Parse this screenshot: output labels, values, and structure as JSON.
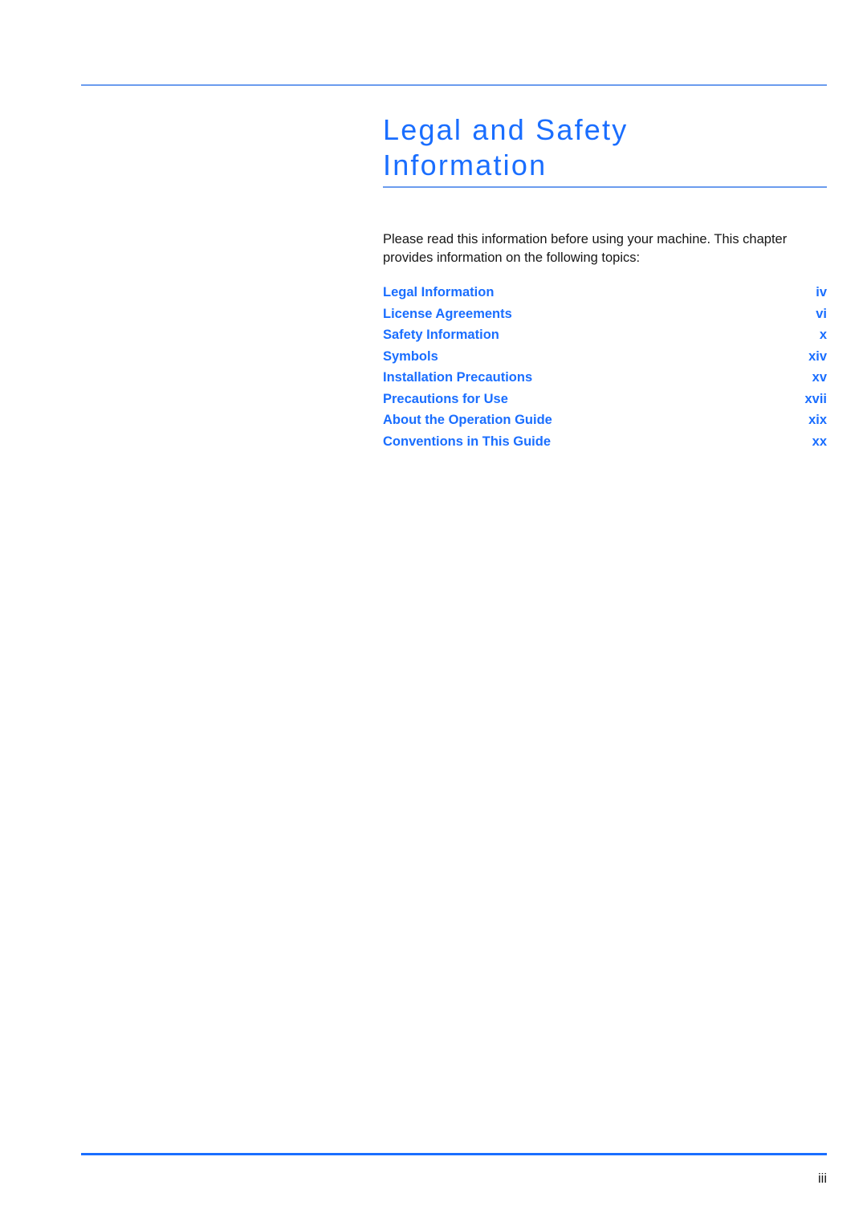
{
  "document": {
    "title": "Legal and Safety\nInformation",
    "intro": "Please read this information before using your machine. This chapter provides information on the following topics:",
    "footer_page_number": "iii"
  },
  "topics": [
    {
      "label": "Legal Information",
      "page": "iv"
    },
    {
      "label": "License Agreements",
      "page": "vi"
    },
    {
      "label": "Safety Information",
      "page": "x"
    },
    {
      "label": "Symbols",
      "page": "xiv"
    },
    {
      "label": "Installation Precautions",
      "page": "xv"
    },
    {
      "label": "Precautions for Use",
      "page": "xvii"
    },
    {
      "label": "About the Operation Guide",
      "page": "xix"
    },
    {
      "label": "Conventions in This Guide",
      "page": "xx"
    }
  ],
  "colors": {
    "accent_blue": "#1a6eff",
    "rule_light_blue": "#6b9cee",
    "body_text": "#161616"
  }
}
